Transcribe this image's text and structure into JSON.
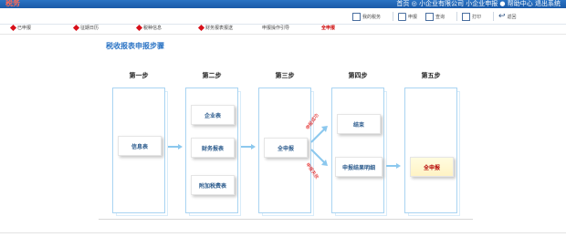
{
  "topbar": {
    "logo": "税务",
    "info": "首页  ◎ 小企业有限公司  小企业申报 ● 帮助中心  退出系统"
  },
  "toolbar": [
    {
      "label": "我的税务",
      "icon": "document-icon"
    },
    {
      "label": "申报",
      "icon": "pencil-icon"
    },
    {
      "label": "查询",
      "icon": "search-icon"
    },
    {
      "label": "打印",
      "icon": "printer-icon"
    },
    {
      "label": "返回",
      "icon": "back-arrow-icon"
    }
  ],
  "tabs": [
    "已申报",
    "征期日历",
    "税种信息",
    "财务报表报送",
    "申报操作引导",
    "全申报"
  ],
  "title": "税收报表申报步骤",
  "steps": [
    "第一步",
    "第二步",
    "第三步",
    "第四步",
    "第五步"
  ],
  "step1": {
    "box": "信息表"
  },
  "step2": {
    "boxes": [
      "企业表",
      "财务报表",
      "附加税费表"
    ]
  },
  "step3": {
    "box": "全申报"
  },
  "step4": {
    "boxes": [
      "结束",
      "申报结果明细"
    ],
    "labels": [
      "申报成功",
      "申报失败"
    ]
  },
  "step5": {
    "box": "全申报"
  },
  "colors": {
    "accent": "#2a73c4",
    "highlight": "#b40000",
    "arrow": "#8cc8ee"
  }
}
